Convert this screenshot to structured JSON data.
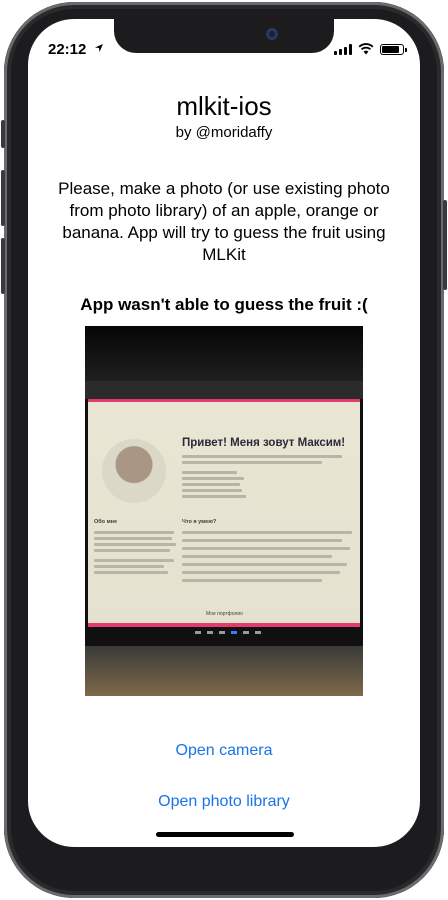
{
  "status_bar": {
    "time": "22:12",
    "icons": [
      "location-arrow-icon",
      "cellular-signal-icon",
      "wifi-icon",
      "battery-icon"
    ],
    "battery_level": 0.9
  },
  "app": {
    "title": "mlkit-ios",
    "subtitle": "by @moridaffy",
    "instructions": "Please, make a photo (or use existing photo from photo library) of an apple, orange or banana. App will try to guess the fruit using MLKit",
    "result": "App wasn't able to guess the fruit :("
  },
  "photo": {
    "heading": "Привет! Меня зовут Максим!",
    "section_about": "Обо мне",
    "section_skills": "Что я умею?",
    "footer": "Мое портфолио"
  },
  "actions": {
    "open_camera": "Open camera",
    "open_library": "Open photo library"
  },
  "colors": {
    "link": "#1a73e8",
    "accent_pink": "#e63a6f"
  }
}
